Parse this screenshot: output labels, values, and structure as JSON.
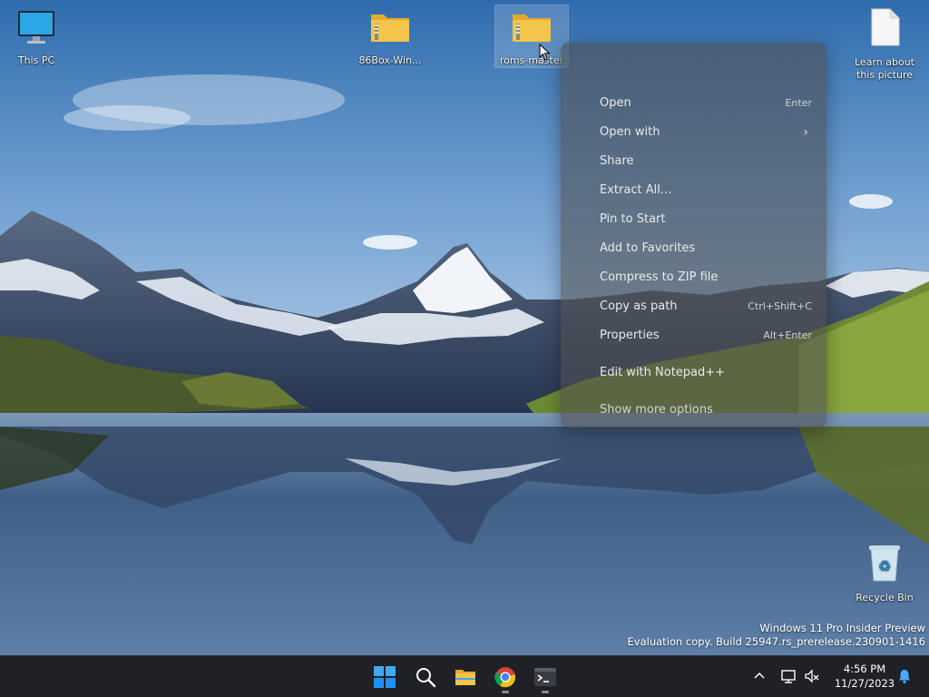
{
  "desktop": {
    "icons": [
      {
        "label": "This PC",
        "icon": "monitor-icon"
      },
      {
        "label": "86Box-Win...",
        "icon": "zip-folder-icon"
      },
      {
        "label": "roms-master",
        "icon": "zip-folder-icon"
      },
      {
        "label": "Learn about this picture",
        "icon": "document-icon"
      },
      {
        "label": "Recycle Bin",
        "icon": "recycle-bin-icon"
      }
    ]
  },
  "context_menu": {
    "items": [
      {
        "label": "Open",
        "shortcut": "Enter"
      },
      {
        "label": "Open with",
        "submenu": true
      },
      {
        "label": "Share"
      },
      {
        "label": "Extract All..."
      },
      {
        "label": "Pin to Start"
      },
      {
        "label": "Add to Favorites"
      },
      {
        "label": "Compress to ZIP file"
      },
      {
        "label": "Copy as path",
        "shortcut": "Ctrl+Shift+C"
      },
      {
        "label": "Properties",
        "shortcut": "Alt+Enter"
      },
      {
        "label": "Edit with Notepad++"
      },
      {
        "label": "Show more options"
      }
    ]
  },
  "watermark": {
    "line1": "Windows 11 Pro Insider Preview",
    "line2": "Evaluation copy. Build 25947.rs_prerelease.230901-1416"
  },
  "taskbar": {
    "pinned": [
      {
        "icon": "windows-start-icon",
        "running": false
      },
      {
        "icon": "search-icon",
        "running": false
      },
      {
        "icon": "file-explorer-icon",
        "running": false
      },
      {
        "icon": "chrome-icon",
        "running": true
      },
      {
        "icon": "terminal-icon",
        "running": true
      }
    ],
    "tray": {
      "icons": [
        "chevron-up-icon",
        "network-icon",
        "volume-muted-icon",
        "notification-bell-icon"
      ]
    },
    "clock": {
      "time": "4:56 PM",
      "date": "11/27/2023"
    }
  },
  "colors": {
    "taskbar_bg": "#1f2126",
    "menu_bg": "rgba(78,78,78,0.58)",
    "windows_blue": "#1e90ff",
    "folder_yellow": "#f4c54b"
  }
}
